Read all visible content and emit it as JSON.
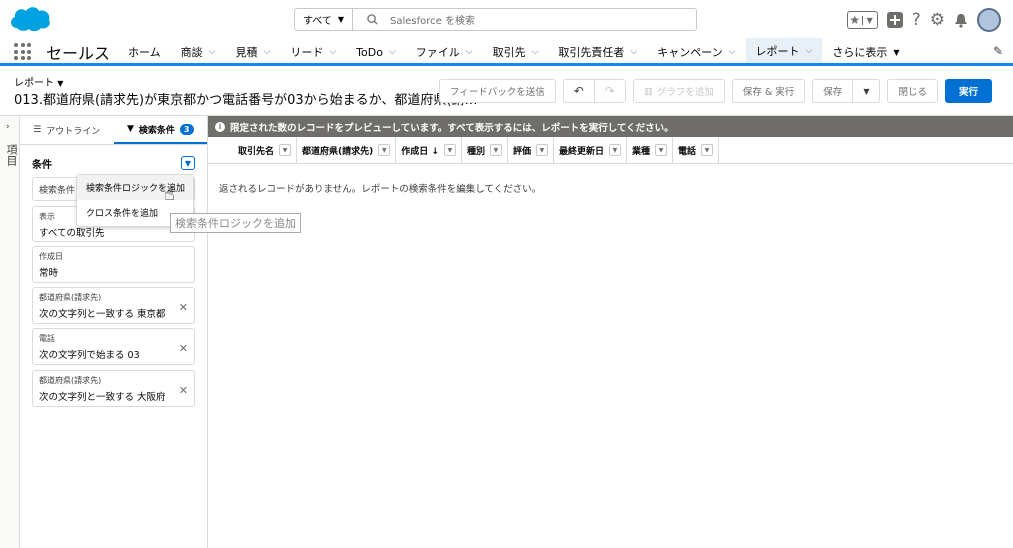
{
  "topbar": {
    "search_scope": "すべて",
    "search_placeholder": "Salesforce を検索"
  },
  "nav": {
    "app_name": "セールス",
    "items": [
      {
        "label": "ホーム",
        "chevron": false
      },
      {
        "label": "商談",
        "chevron": true
      },
      {
        "label": "見積",
        "chevron": true
      },
      {
        "label": "リード",
        "chevron": true
      },
      {
        "label": "ToDo",
        "chevron": true
      },
      {
        "label": "ファイル",
        "chevron": true
      },
      {
        "label": "取引先",
        "chevron": true
      },
      {
        "label": "取引先責任者",
        "chevron": true
      },
      {
        "label": "キャンペーン",
        "chevron": true
      },
      {
        "label": "レポート",
        "chevron": true,
        "active": true
      },
      {
        "label": "さらに表示",
        "chevron": true
      }
    ]
  },
  "header": {
    "breadcrumb": "レポート",
    "title": "013.都道府県(請求先)が東京都かつ電話番号が03から始まるか、都道府県(請…",
    "buttons": {
      "feedback": "フィードバックを送信",
      "add_chart": "グラフを追加",
      "save_run": "保存 & 実行",
      "save": "保存",
      "close": "閉じる",
      "run": "実行"
    }
  },
  "left_rail": {
    "label": "項目"
  },
  "panel": {
    "tab_outline": "アウトライン",
    "tab_filters": "検索条件",
    "filter_count": "3",
    "section_title": "条件",
    "add_filter_placeholder": "検索条件",
    "filters": [
      {
        "label": "表示",
        "value": "すべての取引先",
        "removable": false
      },
      {
        "label": "作成日",
        "value": "常時",
        "removable": false
      },
      {
        "label": "都道府県(請求先)",
        "value": "次の文字列と一致する 東京都",
        "removable": true
      },
      {
        "label": "電話",
        "value": "次の文字列で始まる 03",
        "removable": true
      },
      {
        "label": "都道府県(請求先)",
        "value": "次の文字列と一致する 大阪府",
        "removable": true
      }
    ],
    "menu": {
      "add_logic": "検索条件ロジックを追加",
      "add_cross": "クロス条件を追加"
    },
    "tooltip": "検索条件ロジックを追加"
  },
  "preview": {
    "banner": "限定された数のレコードをプレビューしています。すべて表示するには、レポートを実行してください。",
    "columns": [
      "取引先名",
      "都道府県(請求先)",
      "作成日 ↓",
      "種別",
      "評価",
      "最終更新日",
      "業種",
      "電話"
    ],
    "empty_message": "返されるレコードがありません。レポートの検索条件を編集してください。"
  }
}
